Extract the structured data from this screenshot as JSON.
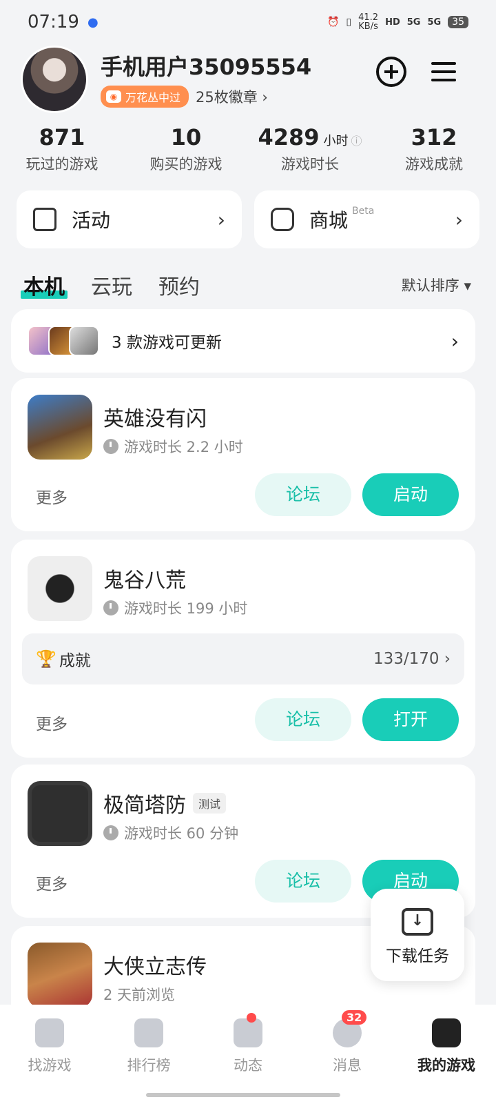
{
  "status": {
    "time": "07:19",
    "net_speed": "41.2",
    "net_unit": "KB/s",
    "signal1": "5G",
    "signal2": "5G",
    "battery": "35"
  },
  "profile": {
    "username": "手机用户35095554",
    "badge": "万花丛中过",
    "medals": "25枚徽章 ›"
  },
  "stats": [
    {
      "value": "871",
      "unit": "",
      "label": "玩过的游戏"
    },
    {
      "value": "10",
      "unit": "",
      "label": "购买的游戏"
    },
    {
      "value": "4289",
      "unit": "小时",
      "label": "游戏时长"
    },
    {
      "value": "312",
      "unit": "",
      "label": "游戏成就"
    }
  ],
  "quick": {
    "activity": "活动",
    "shop": "商城",
    "shop_tag": "Beta"
  },
  "tabs": [
    "本机",
    "云玩",
    "预约"
  ],
  "sort": "默认排序 ▾",
  "update_banner": "3 款游戏可更新",
  "games": [
    {
      "name": "英雄没有闪",
      "time": "游戏时长 2.2 小时",
      "more": "更多",
      "forum": "论坛",
      "action": "启动"
    },
    {
      "name": "鬼谷八荒",
      "time": "游戏时长 199 小时",
      "achievement_label": "成就",
      "achievement_value": "133/170 ›",
      "more": "更多",
      "forum": "论坛",
      "action": "打开"
    },
    {
      "name": "极简塔防",
      "tag": "测试",
      "time": "游戏时长 60 分钟",
      "more": "更多",
      "forum": "论坛",
      "action": "启动"
    },
    {
      "name": "大侠立志传",
      "time": "2 天前浏览"
    }
  ],
  "download_task": "下载任务",
  "nav": [
    {
      "label": "找游戏"
    },
    {
      "label": "排行榜"
    },
    {
      "label": "动态"
    },
    {
      "label": "消息",
      "badge": "32"
    },
    {
      "label": "我的游戏"
    }
  ],
  "colors": {
    "accent": "#19cdb8",
    "badge": "#ff8f4f",
    "alert": "#ff4b4b"
  }
}
